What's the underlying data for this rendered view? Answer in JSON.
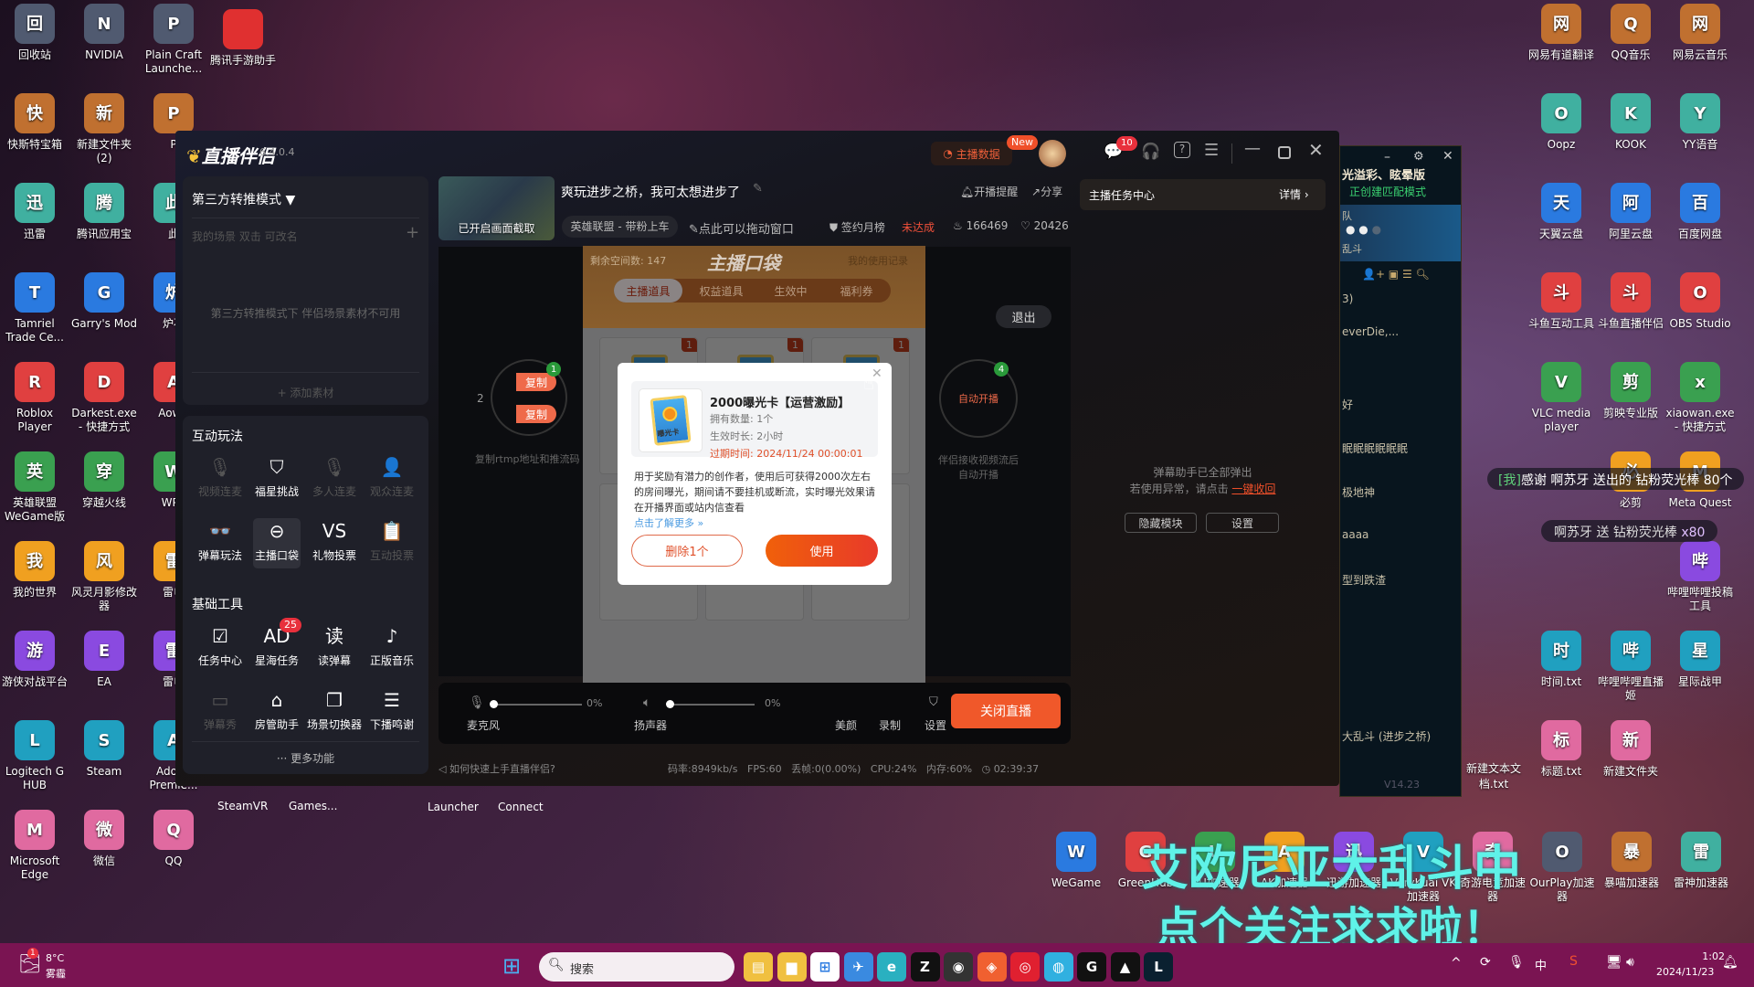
{
  "desktop": {
    "left_col1": [
      "回收站",
      "快斯特宝箱",
      "迅雷",
      "Tamriel Trade Ce...",
      "Roblox Player",
      "英雄联盟 WeGame版",
      "我的世界",
      "游侠对战平台",
      "Logitech G HUB",
      "Microsoft Edge"
    ],
    "left_col2": [
      "NVIDIA",
      "新建文件夹 (2)",
      "腾讯应用宝",
      "Garry's Mod",
      "Darkest.exe - 快捷方式",
      "穿越火线",
      "风灵月影修改器",
      "EA",
      "Steam",
      "微信"
    ],
    "left_col3": [
      "Plain Craft Launche...",
      "P",
      "此",
      "炉石",
      "AowC",
      "WPS",
      "雷电",
      "雷电",
      "Adobe Premie...",
      "QQ"
    ],
    "left_col4_top": "腾讯手游助手",
    "hidden_labels": [
      "SteamVR",
      "Games...",
      "Launcher",
      "Connect"
    ],
    "right_colA": [
      "网易有道翻译",
      "Oopz",
      "天翼云盘",
      "斗鱼互动工具",
      "VLC media player",
      "",
      "",
      "时间.txt",
      "标题.txt"
    ],
    "right_colB": [
      "QQ音乐",
      "KOOK",
      "阿里云盘",
      "斗鱼直播伴侣",
      "剪映专业版",
      "必剪",
      "",
      "哔哩哔哩直播姬",
      "新建文件夹"
    ],
    "right_colC": [
      "网易云音乐",
      "YY语音",
      "百度网盘",
      "OBS Studio",
      "xiaowan.exe - 快捷方式",
      "Meta Quest",
      "哔哩哔哩投稿工具",
      "星际战甲"
    ],
    "extra_txt": "新建文本文档.txt",
    "bottom_row": [
      "WeGame",
      "GreenHub",
      "UU加速器",
      "AK加速器",
      "迅游加速器",
      "VeryKuai VK加速器",
      "奇游电竞加速器",
      "OurPlay加速器",
      "暴喵加速器",
      "雷神加速器"
    ]
  },
  "overlay": {
    "line1": "艾欧尼亚大乱斗中",
    "line2": "点个关注求求啦！",
    "danmaku1_tag": "[我]",
    "danmaku1": "感谢 啊苏牙 送出的 钻粉荧光棒 80个",
    "danmaku2": "啊苏牙 送 钻粉荧光棒",
    "danmaku2_count": "x80",
    "color": "#5ff2e8"
  },
  "app": {
    "title": "直播伴侣",
    "version": "6.4.0.4",
    "data_button": "主播数据",
    "new_badge": "New",
    "message_badge": "10",
    "scene": {
      "mode": "第三方转推模式 ▼",
      "tabs_hint": "我的场景  双击  可改名",
      "empty": "第三方转推模式下 伴侣场景素材不可用",
      "add": "+ 添加素材"
    },
    "interact": {
      "heading": "互动玩法",
      "items": [
        {
          "label": "视频连麦",
          "icon": "mic-video-icon",
          "glyph": "🎙",
          "disabled": true
        },
        {
          "label": "福星挑战",
          "icon": "shield-star-icon",
          "glyph": "⛉",
          "disabled": false
        },
        {
          "label": "多人连麦",
          "icon": "multi-mic-icon",
          "glyph": "🎙",
          "disabled": true
        },
        {
          "label": "观众连麦",
          "icon": "audience-mic-icon",
          "glyph": "👤",
          "disabled": true
        },
        {
          "label": "弹幕玩法",
          "icon": "danmaku-glasses-icon",
          "glyph": "👓",
          "disabled": false
        },
        {
          "label": "主播口袋",
          "icon": "pocket-icon",
          "glyph": "⊖",
          "disabled": false,
          "active": true
        },
        {
          "label": "礼物投票",
          "icon": "vs-vote-icon",
          "glyph": "VS",
          "disabled": false
        },
        {
          "label": "互动投票",
          "icon": "clipboard-vote-icon",
          "glyph": "📋",
          "disabled": true
        }
      ]
    },
    "tools": {
      "heading": "基础工具",
      "items": [
        {
          "label": "任务中心",
          "icon": "task-check-icon",
          "glyph": "☑",
          "disabled": false
        },
        {
          "label": "星海任务",
          "icon": "ad-icon",
          "glyph": "AD",
          "disabled": false,
          "badge": "25"
        },
        {
          "label": "读弹幕",
          "icon": "read-danmaku-icon",
          "glyph": "读",
          "disabled": false
        },
        {
          "label": "正版音乐",
          "icon": "music-icon",
          "glyph": "♪",
          "disabled": false
        },
        {
          "label": "弹幕秀",
          "icon": "tv-icon",
          "glyph": "▭",
          "disabled": true
        },
        {
          "label": "房管助手",
          "icon": "house-icon",
          "glyph": "⌂",
          "disabled": false
        },
        {
          "label": "场景切换器",
          "icon": "switch-scene-icon",
          "glyph": "❐",
          "disabled": false
        },
        {
          "label": "下播鸣谢",
          "icon": "thanks-icon",
          "glyph": "☰",
          "disabled": false
        }
      ]
    },
    "more": "··· 更多功能",
    "stream": {
      "thumb_label": "已开启画面截取",
      "title": "爽玩进步之桥，我可太想进步了",
      "remind": "开播提醒",
      "share": "分享",
      "category": "英雄联盟 - 带粉上车",
      "drag_hint": "点此可以拖动窗口",
      "rank": "签约月榜",
      "rank_status": "未达成",
      "hot": "166469",
      "likes": "20426"
    },
    "preview": {
      "copy": "复制",
      "copy_badge": "1",
      "copy_hint": "复制rtmp地址和推流码",
      "exit": "退出",
      "auto": "自动开播",
      "auto_badge": "4",
      "auto_hint1": "伴侣接收视频流后",
      "auto_hint2": "自动开播",
      "left_partial": "2"
    },
    "pocket": {
      "space": "剩余空间数: 147",
      "title": "主播口袋",
      "history": "我的使用记录",
      "tabs": [
        "主播道具",
        "权益道具",
        "生效中",
        "福利券"
      ],
      "card_badge": "1"
    },
    "dialog": {
      "name": "2000曝光卡【运营激励】",
      "count": "拥有数量: 1个",
      "duration": "生效时长: 2小时",
      "expire": "过期时间: 2024/11/24 00:00:01",
      "card_text": "曝光卡",
      "desc": "用于奖励有潜力的创作者，使用后可获得2000次左右的房间曝光，期间请不要挂机或断流，实时曝光效果请在开播界面或站内信查看",
      "more": "点击了解更多 »",
      "delete": "删除1个",
      "use": "使用"
    },
    "controls": {
      "mic": "麦克风",
      "mic_pct": "0%",
      "mic_level": 0,
      "speaker": "扬声器",
      "speaker_pct": "0%",
      "speaker_level": 0,
      "beauty": "美颜",
      "record": "录制",
      "settings": "设置",
      "stop": "关闭直播"
    },
    "status": {
      "help": "如何快速上手直播伴侣?",
      "bitrate": "码率:8949kb/s",
      "fps": "FPS:60",
      "drop": "丢帧:0(0.00%)",
      "cpu": "CPU:24%",
      "mem": "内存:60%",
      "time": "02:39:37"
    },
    "right": {
      "task_center": "主播任务中心",
      "detail": "详情 ›",
      "info1": "弹幕助手已全部弹出",
      "info2": "若使用异常，请点击 ",
      "recall": "一键收回",
      "hide": "隐藏模块",
      "settings": "设置"
    },
    "accent": "#f05a2a"
  },
  "lol": {
    "title": "光溢彩、眩晕版",
    "status": "正创建匹配模式",
    "team": "队",
    "mode": "乱斗",
    "group": "3)",
    "friends": [
      "everDie,...",
      "好",
      "眠眠眠眠眠眠",
      "极地神",
      "aaaa",
      "型到跌渣"
    ],
    "game": "大乱斗 (进步之桥)",
    "version": "V14.23"
  },
  "taskbar": {
    "temp": "8°C",
    "weather": "雾霾",
    "weather_badge": "1",
    "search": "搜索",
    "time": "1:02",
    "date": "2024/11/23",
    "ime": "中",
    "color": "#7a1452"
  }
}
